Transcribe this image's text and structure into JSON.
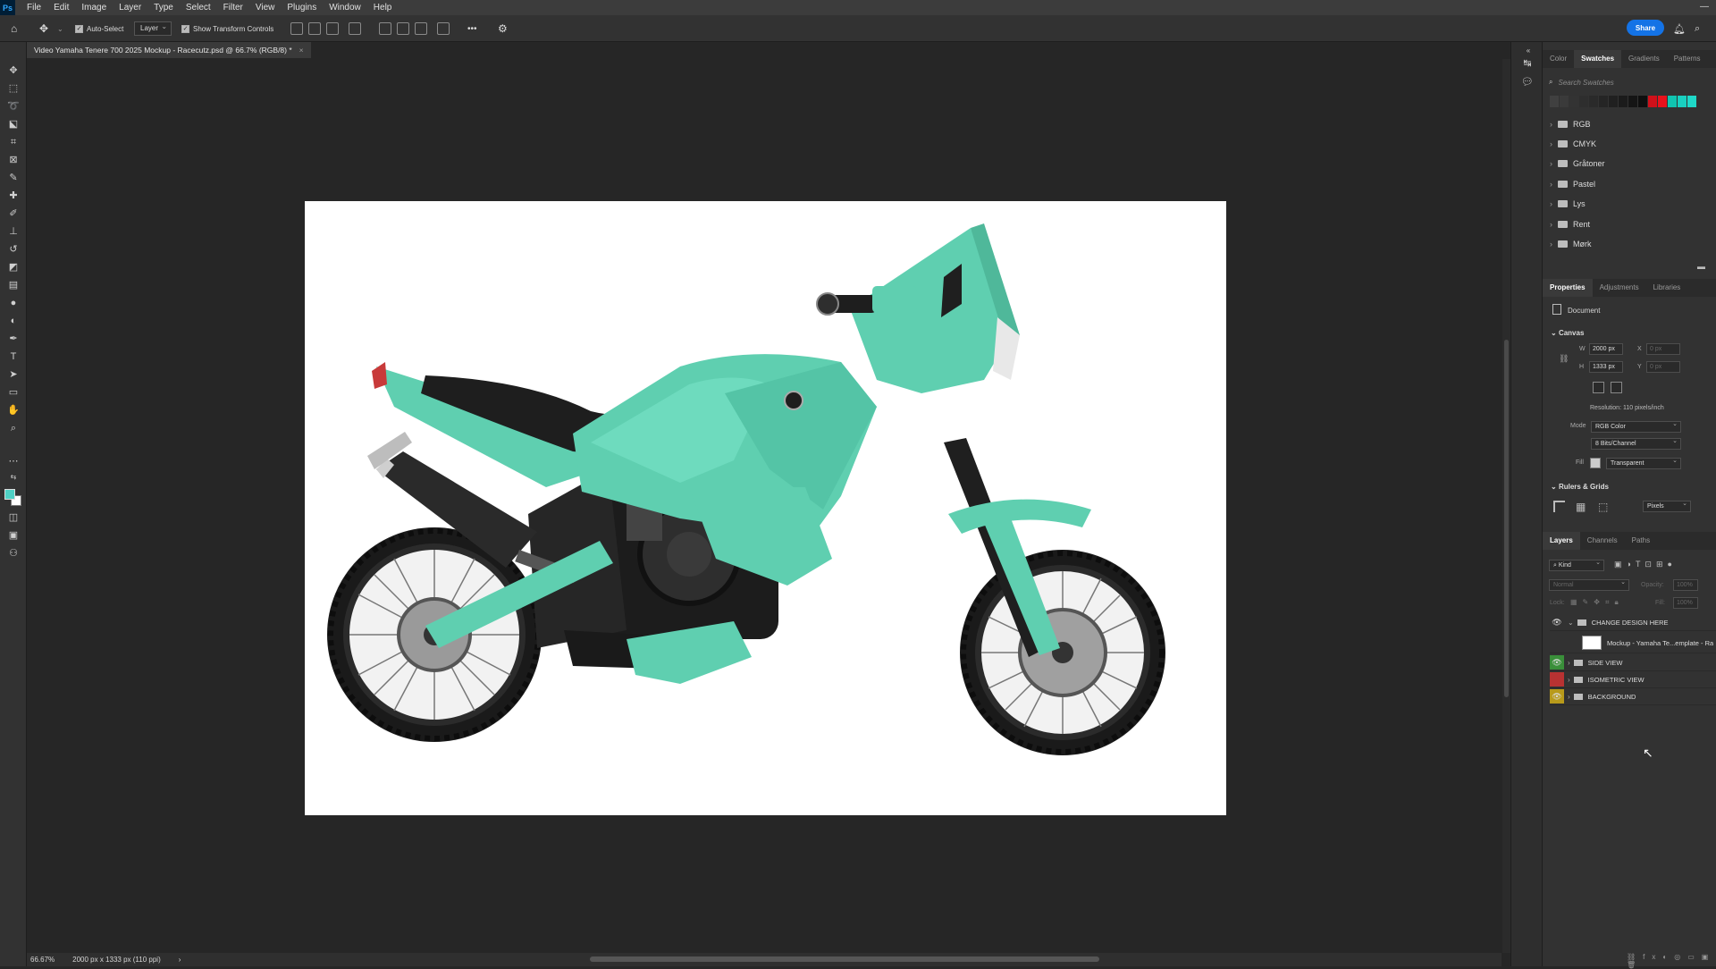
{
  "app": {
    "logo": "Ps",
    "minimize": "—"
  },
  "menu": [
    "File",
    "Edit",
    "Image",
    "Layer",
    "Type",
    "Select",
    "Filter",
    "View",
    "Plugins",
    "Window",
    "Help"
  ],
  "options_bar": {
    "auto_select_label": "Auto-Select",
    "layer_select": "Layer",
    "transform_label": "Show Transform Controls",
    "more": "•••",
    "share": "Share"
  },
  "document_tab": {
    "title": "Video Yamaha Tenere 700 2025 Mockup - Racecutz.psd @ 66.7% (RGB/8) *",
    "close": "×"
  },
  "status": {
    "zoom": "66.67%",
    "doc_info": "2000 px x 1333 px (110 ppi)",
    "arrow": "›"
  },
  "swatches_panel": {
    "tabs": [
      "Color",
      "Swatches",
      "Gradients",
      "Patterns"
    ],
    "active_tab": "Swatches",
    "search_placeholder": "Search Swatches",
    "swatch_colors": [
      "#404040",
      "#3a3a3a",
      "#333333",
      "#2e2e2e",
      "#2a2a2a",
      "#252525",
      "#202020",
      "#1b1b1b",
      "#151515",
      "#0f0f0f",
      "#d0101a",
      "#e8121c",
      "#10c4b0",
      "#19d0c0",
      "#1fd8c8"
    ],
    "folders": [
      "RGB",
      "CMYK",
      "Gråtoner",
      "Pastel",
      "Lys",
      "Rent",
      "Mørk"
    ]
  },
  "properties_panel": {
    "tabs": [
      "Properties",
      "Adjustments",
      "Libraries"
    ],
    "active_tab": "Properties",
    "document_label": "Document",
    "canvas_section": "Canvas",
    "w_label": "W",
    "w_value": "2000 px",
    "h_label": "H",
    "h_value": "1333 px",
    "x_label": "X",
    "x_value": "0 px",
    "y_label": "Y",
    "y_value": "0 px",
    "resolution": "Resolution: 110 pixels/inch",
    "mode_label": "Mode",
    "mode_value": "RGB Color",
    "bits_value": "8 Bits/Channel",
    "fill_label": "Fill",
    "fill_value": "Transparent",
    "rulers_section": "Rulers & Grids",
    "units_value": "Pixels"
  },
  "layers_panel": {
    "tabs": [
      "Layers",
      "Channels",
      "Paths"
    ],
    "active_tab": "Layers",
    "kind_label": "Kind",
    "blend_mode": "Normal",
    "opacity_label": "Opacity:",
    "opacity_value": "100%",
    "lock_label": "Lock:",
    "fill_label": "Fill:",
    "fill_value": "100%",
    "layers": [
      {
        "name": "CHANGE DESIGN HERE",
        "eye_color": "",
        "type": "group-open"
      },
      {
        "name": "Mockup - Yamaha Te...emplate - Ra",
        "eye_color": "",
        "type": "smart"
      },
      {
        "name": "SIDE VIEW",
        "eye_color": "#3a8f3a",
        "type": "group"
      },
      {
        "name": "ISOMETRIC VIEW",
        "eye_color": "#b83232",
        "type": "group"
      },
      {
        "name": "BACKGROUND",
        "eye_color": "#b89a1a",
        "type": "group"
      }
    ]
  },
  "colors": {
    "accent": "#1473e6",
    "bike_body": "#5fcfb0",
    "foreground": "#4fd1c5"
  }
}
